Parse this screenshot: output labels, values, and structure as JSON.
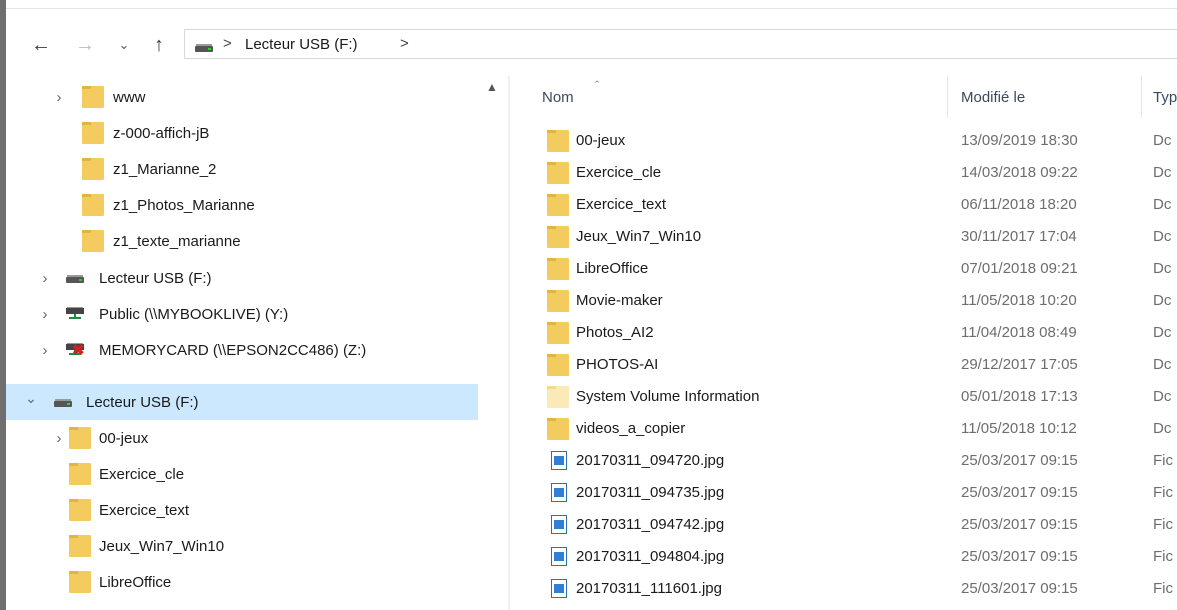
{
  "address_bar": {
    "path_label": "Lecteur USB (F:)",
    "separator": ">"
  },
  "navigation_pane": {
    "items": [
      {
        "label": "www",
        "icon": "folder-icon",
        "indent": 1,
        "expander": "collapsed"
      },
      {
        "label": "z-000-affich-jB",
        "icon": "folder-icon",
        "indent": 1,
        "expander": "none"
      },
      {
        "label": "z1_Marianne_2",
        "icon": "folder-icon",
        "indent": 1,
        "expander": "none"
      },
      {
        "label": "z1_Photos_Marianne",
        "icon": "folder-icon",
        "indent": 1,
        "expander": "none"
      },
      {
        "label": "z1_texte_marianne",
        "icon": "folder-icon",
        "indent": 1,
        "expander": "none"
      },
      {
        "label": "Lecteur USB (F:)",
        "icon": "usb-drive-icon",
        "indent": 0,
        "expander": "collapsed"
      },
      {
        "label": "Public (\\\\MYBOOKLIVE) (Y:)",
        "icon": "network-drive-icon",
        "indent": 0,
        "expander": "collapsed"
      },
      {
        "label": "MEMORYCARD (\\\\EPSON2CC486) (Z:)",
        "icon": "disconnected-network-drive-icon",
        "indent": 0,
        "expander": "collapsed"
      },
      {
        "label": "Lecteur USB (F:)",
        "icon": "usb-drive-icon",
        "indent": 0,
        "expander": "expanded",
        "selected": true
      },
      {
        "label": "00-jeux",
        "icon": "folder-icon",
        "indent": 1,
        "expander": "collapsed"
      },
      {
        "label": "Exercice_cle",
        "icon": "folder-icon",
        "indent": 1,
        "expander": "none"
      },
      {
        "label": "Exercice_text",
        "icon": "folder-icon",
        "indent": 1,
        "expander": "none"
      },
      {
        "label": "Jeux_Win7_Win10",
        "icon": "folder-icon",
        "indent": 1,
        "expander": "none"
      },
      {
        "label": "LibreOffice",
        "icon": "folder-icon",
        "indent": 1,
        "expander": "none"
      }
    ]
  },
  "columns": {
    "name": "Nom",
    "modified": "Modifié le",
    "type": "Typ"
  },
  "files": [
    {
      "name": "00-jeux",
      "modified": "13/09/2019 18:30",
      "type": "Dc",
      "icon": "folder-icon"
    },
    {
      "name": "Exercice_cle",
      "modified": "14/03/2018 09:22",
      "type": "Dc",
      "icon": "folder-icon"
    },
    {
      "name": "Exercice_text",
      "modified": "06/11/2018 18:20",
      "type": "Dc",
      "icon": "folder-icon"
    },
    {
      "name": "Jeux_Win7_Win10",
      "modified": "30/11/2017 17:04",
      "type": "Dc",
      "icon": "folder-icon"
    },
    {
      "name": "LibreOffice",
      "modified": "07/01/2018 09:21",
      "type": "Dc",
      "icon": "folder-icon"
    },
    {
      "name": "Movie-maker",
      "modified": "11/05/2018 10:20",
      "type": "Dc",
      "icon": "folder-icon"
    },
    {
      "name": "Photos_AI2",
      "modified": "11/04/2018 08:49",
      "type": "Dc",
      "icon": "folder-icon"
    },
    {
      "name": "PHOTOS-AI",
      "modified": "29/12/2017 17:05",
      "type": "Dc",
      "icon": "folder-icon"
    },
    {
      "name": "System Volume Information",
      "modified": "05/01/2018 17:13",
      "type": "Dc",
      "icon": "system-folder-icon"
    },
    {
      "name": "videos_a_copier",
      "modified": "11/05/2018 10:12",
      "type": "Dc",
      "icon": "folder-icon"
    },
    {
      "name": "20170311_094720.jpg",
      "modified": "25/03/2017 09:15",
      "type": "Fic",
      "icon": "image-file-icon"
    },
    {
      "name": "20170311_094735.jpg",
      "modified": "25/03/2017 09:15",
      "type": "Fic",
      "icon": "image-file-icon"
    },
    {
      "name": "20170311_094742.jpg",
      "modified": "25/03/2017 09:15",
      "type": "Fic",
      "icon": "image-file-icon"
    },
    {
      "name": "20170311_094804.jpg",
      "modified": "25/03/2017 09:15",
      "type": "Fic",
      "icon": "image-file-icon"
    },
    {
      "name": "20170311_111601.jpg",
      "modified": "25/03/2017 09:15",
      "type": "Fic",
      "icon": "image-file-icon"
    }
  ],
  "colors": {
    "selection": "#cce8ff",
    "folder": "#f3cb5e",
    "header_text": "#3a4a5e"
  }
}
